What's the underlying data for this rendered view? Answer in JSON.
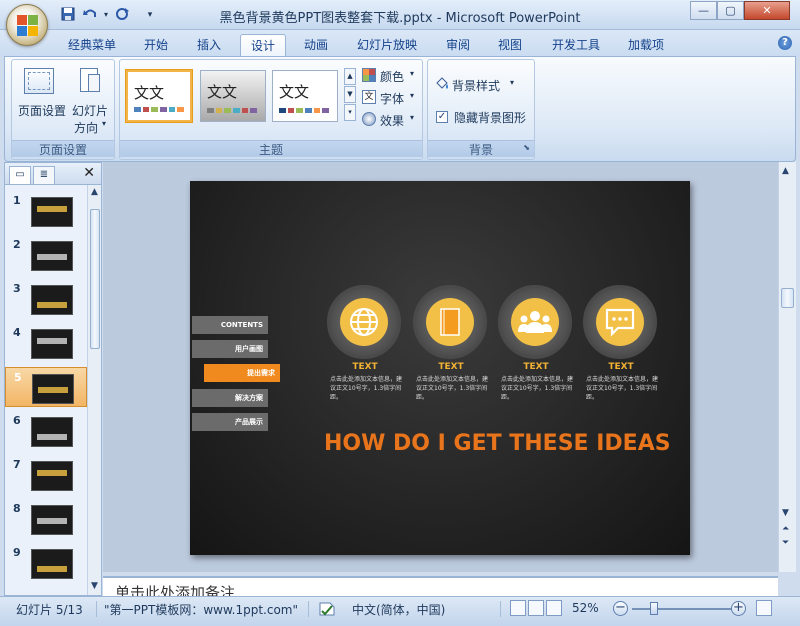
{
  "window": {
    "title": "黑色背景黄色PPT图表整套下载.pptx - Microsoft PowerPoint",
    "controls": {
      "minimize": "—",
      "maximize": "▢",
      "close": "✕"
    }
  },
  "quick_access": [
    {
      "icon": "save-icon"
    },
    {
      "icon": "undo-icon"
    },
    {
      "icon": "redo-icon"
    },
    {
      "icon": "customize-qat-icon"
    }
  ],
  "tabs": [
    "经典菜单",
    "开始",
    "插入",
    "设计",
    "动画",
    "幻灯片放映",
    "审阅",
    "视图",
    "开发工具",
    "加载项"
  ],
  "active_tab": "设计",
  "ribbon": {
    "page_setup_group": {
      "label": "页面设置",
      "page_setup_btn": "页面设置",
      "orientation_btn_line1": "幻灯片",
      "orientation_btn_line2": "方向"
    },
    "themes_group": {
      "label": "主题",
      "themes": [
        {
          "text": "文文",
          "style": "white"
        },
        {
          "text": "文文",
          "style": "gray"
        },
        {
          "text": "文文",
          "style": "white-alt"
        }
      ],
      "colors_btn": "颜色",
      "fonts_btn": "字体",
      "effects_btn": "效果"
    },
    "background_group": {
      "label": "背景",
      "background_styles_btn": "背景样式",
      "hide_bg_checkbox": "隐藏背景图形",
      "hide_bg_checked": true
    }
  },
  "slide_pane": {
    "slides": [
      {
        "num": "1"
      },
      {
        "num": "2"
      },
      {
        "num": "3"
      },
      {
        "num": "4"
      },
      {
        "num": "5"
      },
      {
        "num": "6"
      },
      {
        "num": "7"
      },
      {
        "num": "8"
      },
      {
        "num": "9"
      }
    ],
    "selected": 5
  },
  "slide": {
    "menu": [
      "CONTENTS",
      "用户画图",
      "提出需求",
      "解决方案",
      "产品展示"
    ],
    "menu_active_index": 2,
    "columns": [
      {
        "icon": "globe-icon",
        "title": "TEXT",
        "desc": "点击此处添加文本信息，建议正文10号字，1.3倍字间距。"
      },
      {
        "icon": "book-icon",
        "title": "TEXT",
        "desc": "点击此处添加文本信息，建议正文10号字，1.3倍字间距。"
      },
      {
        "icon": "users-icon",
        "title": "TEXT",
        "desc": "点击此处添加文本信息，建议正文10号字，1.3倍字间距。"
      },
      {
        "icon": "chat-icon",
        "title": "TEXT",
        "desc": "点击此处添加文本信息，建议正文10号字，1.3倍字间距。"
      }
    ],
    "heading": "HOW DO I GET THESE IDEAS"
  },
  "notes_placeholder": "单击此处添加备注",
  "status": {
    "slide_counter": "幻灯片 5/13",
    "theme_name": "\"第一PPT模板网：www.1ppt.com\"",
    "language": "中文(简体，中国)",
    "zoom": "52%"
  },
  "colors": {
    "accent_orange": "#e8741c",
    "icon_yellow": "#f2c046",
    "slide_bg": "#202020",
    "selected_thumb": "#f2b565"
  }
}
